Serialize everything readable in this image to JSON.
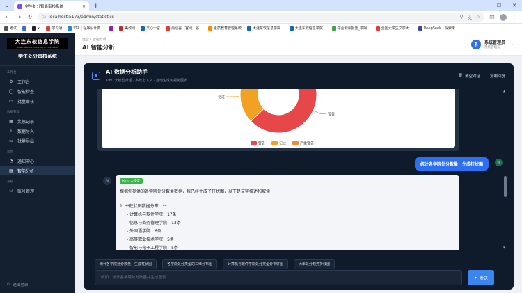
{
  "browser": {
    "tab_title": "学生处分智能审核系统",
    "url": "localhost:5173/admin/statistics",
    "bookmarks": [
      {
        "label": "考试",
        "color": "#555555"
      },
      {
        "label": "",
        "color": "#3a6fd8"
      },
      {
        "label": "xj",
        "color": "#222222"
      },
      {
        "label": "学习通",
        "color": "#e53935"
      },
      {
        "label": "PTA | 程序设计类...",
        "color": "#1e88e5"
      },
      {
        "label": "",
        "color": "#8e24aa"
      },
      {
        "label": "美政网",
        "color": "#c62828"
      },
      {
        "label": "文心一言",
        "color": "#1565c0"
      },
      {
        "label": "尚硅谷【官网】谷...",
        "color": "#e53935"
      },
      {
        "label": "素质教育管理系统",
        "color": "#fb8c00"
      },
      {
        "label": "大连东软信息学院...",
        "color": "#1565c0"
      },
      {
        "label": "大连东软信息学院...",
        "color": "#1565c0"
      },
      {
        "label": "综合测评报告_学期...",
        "color": "#43a047"
      },
      {
        "label": "全国大学生文学大...",
        "color": "#e53935"
      },
      {
        "label": "DeepSeek - 探索未...",
        "color": "#3949ab"
      }
    ]
  },
  "sidebar": {
    "logo_cn": "大连东软信息学院",
    "logo_en": "Dalian Neusoft University of Information",
    "system_name": "学生处分审核系统",
    "groups": [
      {
        "title": "工作台",
        "items": [
          {
            "icon": "⚙",
            "label": "工作台",
            "active": false
          },
          {
            "icon": "◯",
            "label": "智能检查",
            "active": false
          },
          {
            "icon": "▭",
            "label": "批量审核",
            "active": false
          }
        ]
      },
      {
        "title": "数据管理",
        "items": [
          {
            "icon": "▦",
            "label": "奖惩记录",
            "active": false
          },
          {
            "icon": "⤓",
            "label": "数据导入",
            "active": false
          },
          {
            "icon": "▭",
            "label": "批量导出",
            "active": false
          }
        ]
      },
      {
        "title": "运营",
        "items": [
          {
            "icon": "◔",
            "label": "通知中心",
            "active": false
          },
          {
            "icon": "▤",
            "label": "智能分析",
            "active": true
          }
        ]
      },
      {
        "title": "系统",
        "items": [
          {
            "icon": "⚇",
            "label": "账号管理",
            "active": false
          }
        ]
      }
    ],
    "logout_label": "退出登录"
  },
  "header": {
    "breadcrumb": "运营 / 智能分析",
    "title": "AI 智能分析",
    "user_avatar_text": "系",
    "user_name": "系统管理员",
    "user_role": "系统管理员"
  },
  "assistant": {
    "title": "AI 数据分析助手",
    "subtitle": "Kimi 大模型对话 · 多轮上下文 · 自动生成可视化图表",
    "clear_label": "清空对话",
    "copy_label": "复制回复"
  },
  "chart_data": {
    "type": "pie",
    "categories": [
      "警告",
      "记过",
      "严重警告"
    ],
    "values": [
      62,
      23,
      15
    ],
    "colors": [
      "#e84749",
      "#f2a222",
      "#f0893e"
    ],
    "legend": "bottom",
    "slice_labels": [
      "警告",
      "记过",
      ""
    ]
  },
  "conversation": {
    "user_message": "统计各学院处分数量，生成柱状图",
    "user_avatar_text": "我",
    "ai_avatar_text": "AI",
    "model_badge": "Kimi 大模型",
    "ai_intro": "根据你提供的各学院处分数量数据，我已经生成了柱状图，以下是文字描述和解读：",
    "ai_heading": "1. **柱状图数据分布：**",
    "ai_lines": [
      "- 计算机与软件学院：17条",
      "- 信息与商务管理学院：13条",
      "- 外国语学院：6条",
      "- 高等职业技术学院：5条",
      "- 智能与电子工程学院：5条"
    ]
  },
  "suggestions": [
    "统计各学院处分数量，生成柱状图",
    "各学院处分类型的三维分布图",
    "计算机与软件学院处分类型分布饼图",
    "历年处分趋势折线图"
  ],
  "input": {
    "placeholder": "例如：统计各学院处分数量并生成图表..."
  },
  "send_label": "发送"
}
